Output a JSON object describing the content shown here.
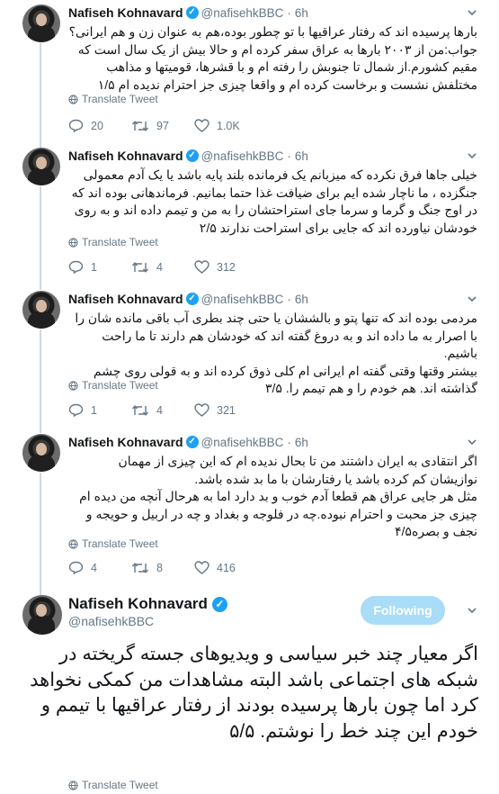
{
  "author": {
    "name": "Nafiseh Kohnavard",
    "handle": "@nafisehkBBC",
    "verified_mark": "✓"
  },
  "translate_label": "Translate Tweet",
  "tweets": [
    {
      "time": "6h",
      "text": "بارها پرسیده اند که رفتار عراقیها با تو چطور بوده،هم به عنوان زن و هم ایرانی؟\nجواب:من از ۲۰۰۳ بارها به عراق سفر کرده ام و حالا بیش از یک سال است که مقیم کشورم.از شمال تا جنوبش را رفته ام و با قشرها، قومیتها و مذاهب مختلفش نشست و برخاست کرده ام و واقعا چیزی جز احترام ندیده ام ۱/۵",
      "replies": "20",
      "retweets": "97",
      "likes": "1.0K"
    },
    {
      "time": "6h",
      "text": "خیلی جاها فرق نکرده که میزبانم یک فرمانده بلند پایه باشد یا یک آدم معمولی جنگزده ، ما ناچار شده ایم برای ضیافت غذا حتما بمانیم. فرماندهانی بوده اند که در اوج جنگ و گرما و سرما جای استراحتشان را به من و تیمم داده اند و به روی خودشان نیاورده اند که جایی برای استراحت ندارند ۲/۵",
      "replies": "1",
      "retweets": "4",
      "likes": "312"
    },
    {
      "time": "6h",
      "text": "مردمی بوده اند که تنها پتو و بالششان یا حتی چند بطری آب باقی مانده شان را با اصرار به ما داده اند و به دروغ گفته اند که خودشان هم دارند تا ما راحت باشیم.\nبیشتر وقتها وقتی گفته ام ایرانی ام کلی ذوق کرده اند و به قولی روی چشم گذاشته اند. هم خودم را و هم تیمم را. ۳/۵",
      "replies": "1",
      "retweets": "4",
      "likes": "321"
    },
    {
      "time": "6h",
      "text": "اگر انتقادی به ایران داشتند من تا بحال ندیده ام که این چیزی از مهمان نوازیشان کم کرده باشد یا رفتارشان با ما بد شده باشد.\nمثل هر جایی عراق هم قطعا آدم خوب و بد دارد اما به هرحال آنچه من دیده ام چیزی جز محبت و احترام نبوده.چه در فلوجه و بغداد و چه در اربیل و حویجه و نجف و بصره۴/۵",
      "replies": "4",
      "retweets": "8",
      "likes": "416"
    }
  ],
  "main_tweet": {
    "follow_label": "Following",
    "text": "اگر معیار چند خبر سیاسی و ویدیوهای جسته گریخته در شبکه های اجتماعی باشد البته مشاهدات من کمکی نخواهد کرد اما چون بارها پرسیده بودند از رفتار عراقیها با تیمم و خودم این چند خط را نوشتم. ۵/۵"
  },
  "colors": {
    "accent": "#1da1f2",
    "muted": "#657786",
    "follow_bg": "#a9dcf6"
  },
  "icons": [
    "reply-icon",
    "retweet-icon",
    "like-icon",
    "globe-icon",
    "chevron-down-icon",
    "verified-icon"
  ]
}
